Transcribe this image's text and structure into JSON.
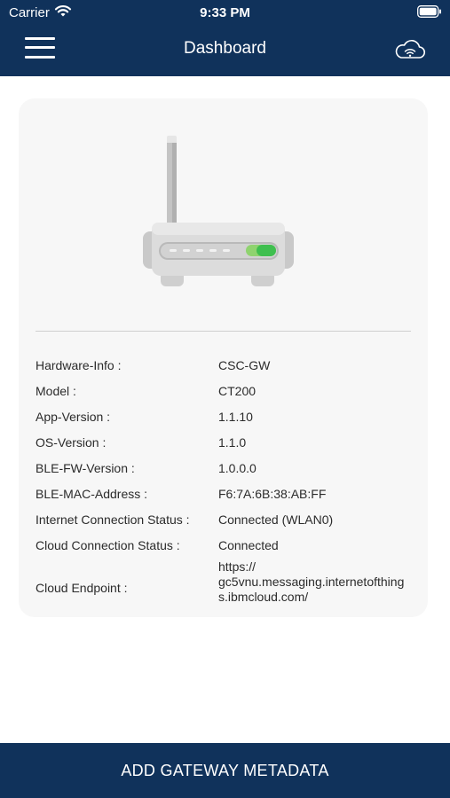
{
  "status_bar": {
    "carrier": "Carrier",
    "time": "9:33 PM"
  },
  "nav": {
    "title": "Dashboard",
    "menu_icon": "hamburger-menu-icon",
    "cloud_icon": "cloud-wifi-icon"
  },
  "device": {
    "illustration": "router-icon",
    "info": [
      {
        "label": "Hardware-Info :",
        "value": "CSC-GW"
      },
      {
        "label": "Model :",
        "value": "CT200"
      },
      {
        "label": "App-Version :",
        "value": "1.1.10"
      },
      {
        "label": "OS-Version :",
        "value": "1.1.0"
      },
      {
        "label": "BLE-FW-Version :",
        "value": "1.0.0.0"
      },
      {
        "label": "BLE-MAC-Address :",
        "value": "F6:7A:6B:38:AB:FF"
      },
      {
        "label": "Internet Connection Status :",
        "value": "Connected (WLAN0)"
      },
      {
        "label": "Cloud Connection Status :",
        "value": "Connected"
      },
      {
        "label": "Cloud Endpoint :",
        "value": "https://\ngc5vnu.messaging.internetofthings.ibmcloud.com/"
      }
    ]
  },
  "footer": {
    "button_label": "ADD GATEWAY METADATA"
  },
  "colors": {
    "header_bg": "#10325b",
    "card_bg": "#f7f7f7",
    "led_green": "#3fbf4f"
  }
}
